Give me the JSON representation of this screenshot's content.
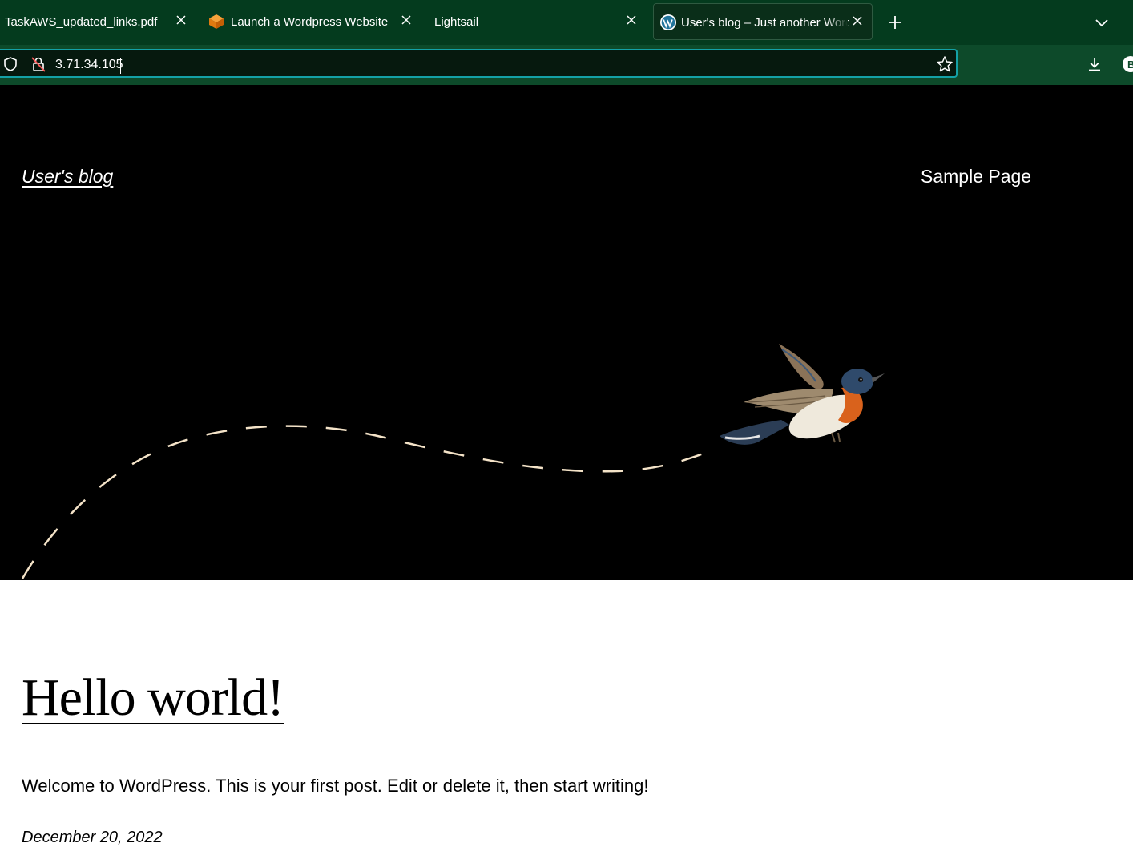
{
  "browser": {
    "tabs": [
      {
        "title": "TaskAWS_updated_links.pdf",
        "icon": "pdf-icon",
        "active": false
      },
      {
        "title": "Launch a Wordpress Website",
        "icon": "aws-cube-icon",
        "active": false
      },
      {
        "title": "Lightsail",
        "icon": "",
        "active": false
      },
      {
        "title": "User's blog – Just another WordPress site",
        "icon": "wordpress-icon",
        "active": true
      }
    ],
    "url": "3.71.34.105",
    "colors": {
      "tabbar": "#043b1e",
      "navbar": "#0d4a2a",
      "focus_ring": "#14a1a6"
    }
  },
  "site": {
    "title": "User's blog",
    "nav": [
      "Sample Page"
    ]
  },
  "post": {
    "title": "Hello world!",
    "excerpt": "Welcome to WordPress. This is your first post. Edit or delete it, then start writing!",
    "date": "December 20, 2022"
  }
}
